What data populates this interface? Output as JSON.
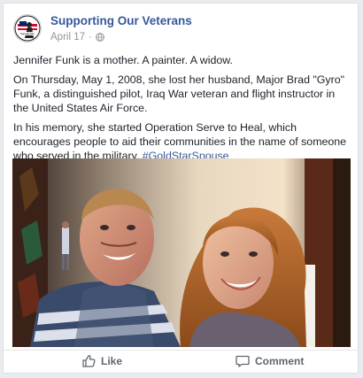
{
  "post": {
    "page_name": "Supporting Our Veterans",
    "date": "April 17",
    "separator": "·",
    "avatar_logo_text": "Support Our Veterans",
    "paragraph1": "Jennifer Funk is a mother. A painter. A widow.",
    "paragraph2": "On Thursday, May 1, 2008, she lost her husband, Major Brad \"Gyro\" Funk, a distinguished pilot, Iraq War veteran and flight instructor in the United States Air Force.",
    "paragraph3_text": "In his memory, she started Operation Serve to Heal, which encourages people to aid their communities in the name of someone who served in the military. ",
    "paragraph3_hashtag": "#GoldStarSpouse"
  },
  "actions": {
    "like_label": "Like",
    "comment_label": "Comment"
  },
  "icons": {
    "globe": "globe-icon",
    "like": "thumbs-up-icon",
    "comment": "speech-bubble-icon"
  },
  "colors": {
    "link": "#365899",
    "meta": "#90949c",
    "action": "#606770"
  }
}
